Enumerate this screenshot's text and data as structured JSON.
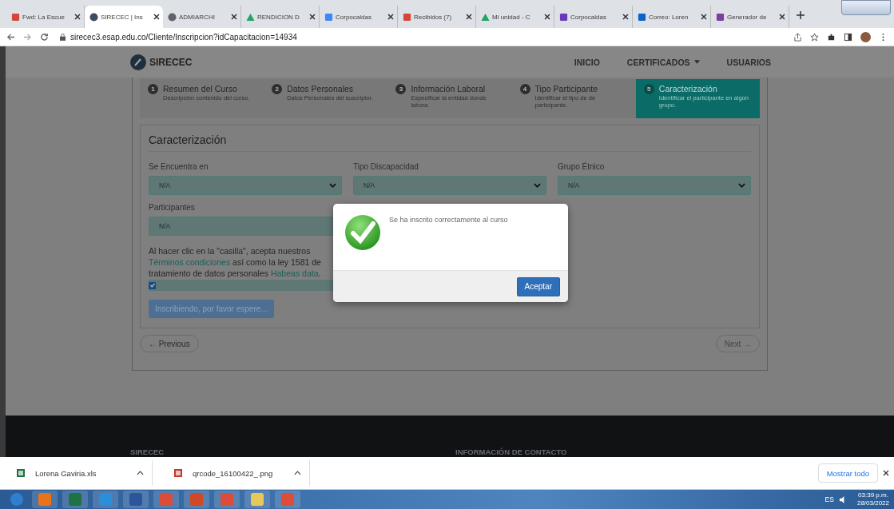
{
  "browser": {
    "tabs": [
      {
        "title": "Fwd: La Escue",
        "kind": "mail",
        "selected": false
      },
      {
        "title": "SIRECEC | Ins",
        "kind": "site",
        "selected": true
      },
      {
        "title": "ADMIARCHI",
        "kind": "globe",
        "selected": false
      },
      {
        "title": "RENDICION D",
        "kind": "drive",
        "selected": false
      },
      {
        "title": "Corpocaldas",
        "kind": "sheet",
        "selected": false
      },
      {
        "title": "Recibidos (7)",
        "kind": "mail",
        "selected": false
      },
      {
        "title": "Mi unidad - C",
        "kind": "drive",
        "selected": false
      },
      {
        "title": "Corpocaldas",
        "kind": "form",
        "selected": false
      },
      {
        "title": "Correo: Loren",
        "kind": "outlook",
        "selected": false
      },
      {
        "title": "Generador de",
        "kind": "qr",
        "selected": false
      }
    ],
    "url": "sirecec3.esap.edu.co/Cliente/Inscripcion?idCapacitacion=14934"
  },
  "navbar": {
    "brand": "SIRECEC",
    "items": [
      {
        "label": "INICIO",
        "dropdown": false
      },
      {
        "label": "CERTIFICADOS",
        "dropdown": true
      },
      {
        "label": "USUARIOS",
        "dropdown": false
      }
    ]
  },
  "steps": [
    {
      "number": "1",
      "title": "Resumen del Curso",
      "description": "Descripción contenido del curso.",
      "selected": false
    },
    {
      "number": "2",
      "title": "Datos Personales",
      "description": "Datos Personales del suscriptor.",
      "selected": false
    },
    {
      "number": "3",
      "title": "Información Laboral",
      "description": "Especificar la entidad donde labora.",
      "selected": false
    },
    {
      "number": "4",
      "title": "Tipo Participante",
      "description": "Identificar el tipo de de participante.",
      "selected": false
    },
    {
      "number": "5",
      "title": "Caracterización",
      "description": "Identificar el participante en algún grupo.",
      "selected": true
    }
  ],
  "form": {
    "title": "Caracterización",
    "selects": [
      {
        "label": "Se Encuentra en",
        "value": "N/A"
      },
      {
        "label": "Tipo Discapacidad",
        "value": "N/A"
      },
      {
        "label": "Grupo Étnico",
        "value": "N/A"
      }
    ],
    "participants": {
      "label": "Participantes",
      "value": "N/A"
    },
    "consent": [
      {
        "text": "Al hacer clic en la \"casilla\", acepta nuestros",
        "kind": "text"
      },
      {
        "text": "Términos",
        "kind": "link"
      },
      {
        "text": "condiciones",
        "kind": "link"
      },
      {
        "text": "así como la ley 1581 de tratamiento de datos personales",
        "kind": "text"
      },
      {
        "text": "Habeas data",
        "kind": "link"
      },
      {
        "text": ".",
        "kind": "text"
      }
    ],
    "accepted": true,
    "submit": "Inscribiendo, por favor espere..."
  },
  "pager": {
    "previous": "← Previous",
    "next": "Next →"
  },
  "footer": {
    "headings": [
      "SIRECEC",
      "INFORMACIÓN DE CONTACTO"
    ]
  },
  "modal": {
    "message": "Se ha inscrito correctamente al curso",
    "button": "Aceptar"
  },
  "downloads": {
    "files": [
      {
        "name": "Lorena Gaviria.xls",
        "kind": "xls"
      },
      {
        "name": "qrcode_16100422_.png",
        "kind": "png"
      }
    ],
    "show_all": "Mostrar todo"
  },
  "taskbar": {
    "apps": [
      {
        "kind": "start"
      },
      {
        "kind": "media"
      },
      {
        "kind": "excel"
      },
      {
        "kind": "ie"
      },
      {
        "kind": "word"
      },
      {
        "kind": "chrome"
      },
      {
        "kind": "powerpoint"
      },
      {
        "kind": "chrome"
      },
      {
        "kind": "explorer"
      },
      {
        "kind": "chrome"
      }
    ],
    "language": "ES",
    "time": "03:39 p.m.",
    "date": "28/03/2022"
  }
}
